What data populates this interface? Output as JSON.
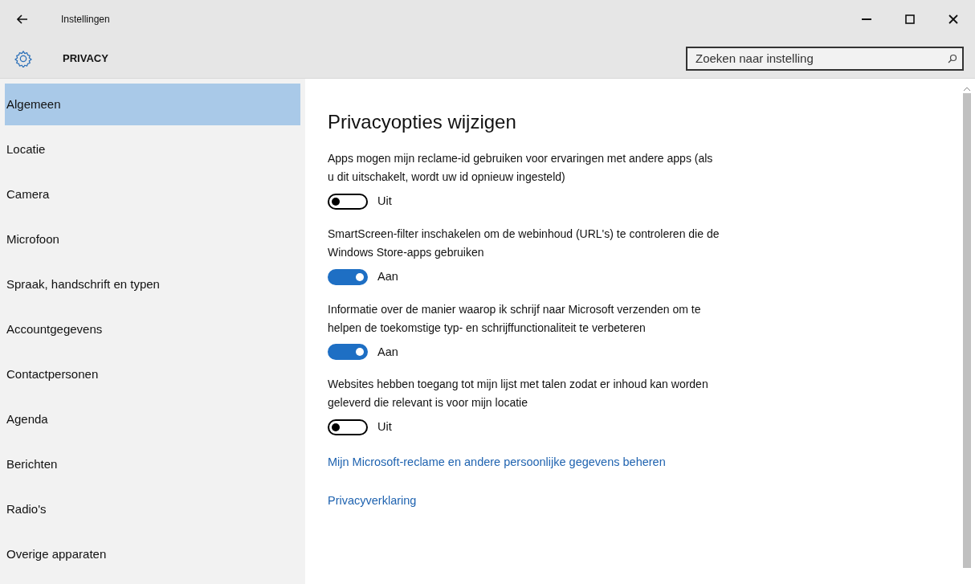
{
  "window": {
    "title": "Instellingen"
  },
  "header": {
    "title": "PRIVACY",
    "search": {
      "placeholder": "Zoeken naar instelling"
    }
  },
  "sidebar": {
    "items": [
      {
        "label": "Algemeen",
        "selected": true
      },
      {
        "label": "Locatie",
        "selected": false
      },
      {
        "label": "Camera",
        "selected": false
      },
      {
        "label": "Microfoon",
        "selected": false
      },
      {
        "label": "Spraak, handschrift en typen",
        "selected": false
      },
      {
        "label": "Accountgegevens",
        "selected": false
      },
      {
        "label": "Contactpersonen",
        "selected": false
      },
      {
        "label": "Agenda",
        "selected": false
      },
      {
        "label": "Berichten",
        "selected": false
      },
      {
        "label": "Radio's",
        "selected": false
      },
      {
        "label": "Overige apparaten",
        "selected": false
      }
    ]
  },
  "content": {
    "heading": "Privacyopties wijzigen",
    "settings": [
      {
        "description": "Apps mogen mijn reclame-id gebruiken voor ervaringen met andere apps (als u dit uitschakelt, wordt uw id opnieuw ingesteld)",
        "on": false,
        "state_label": "Uit"
      },
      {
        "description": "SmartScreen-filter inschakelen om de webinhoud (URL's) te controleren die de Windows Store-apps gebruiken",
        "on": true,
        "state_label": "Aan"
      },
      {
        "description": "Informatie over de manier waarop ik schrijf naar Microsoft verzenden om te helpen de toekomstige typ- en schrijffunctionaliteit te verbeteren",
        "on": true,
        "state_label": "Aan"
      },
      {
        "description": "Websites hebben toegang tot mijn lijst met talen zodat er inhoud kan worden geleverd die relevant is voor mijn locatie",
        "on": false,
        "state_label": "Uit"
      }
    ],
    "links": [
      "Mijn Microsoft-reclame en andere persoonlijke gegevens beheren",
      "Privacyverklaring"
    ]
  }
}
